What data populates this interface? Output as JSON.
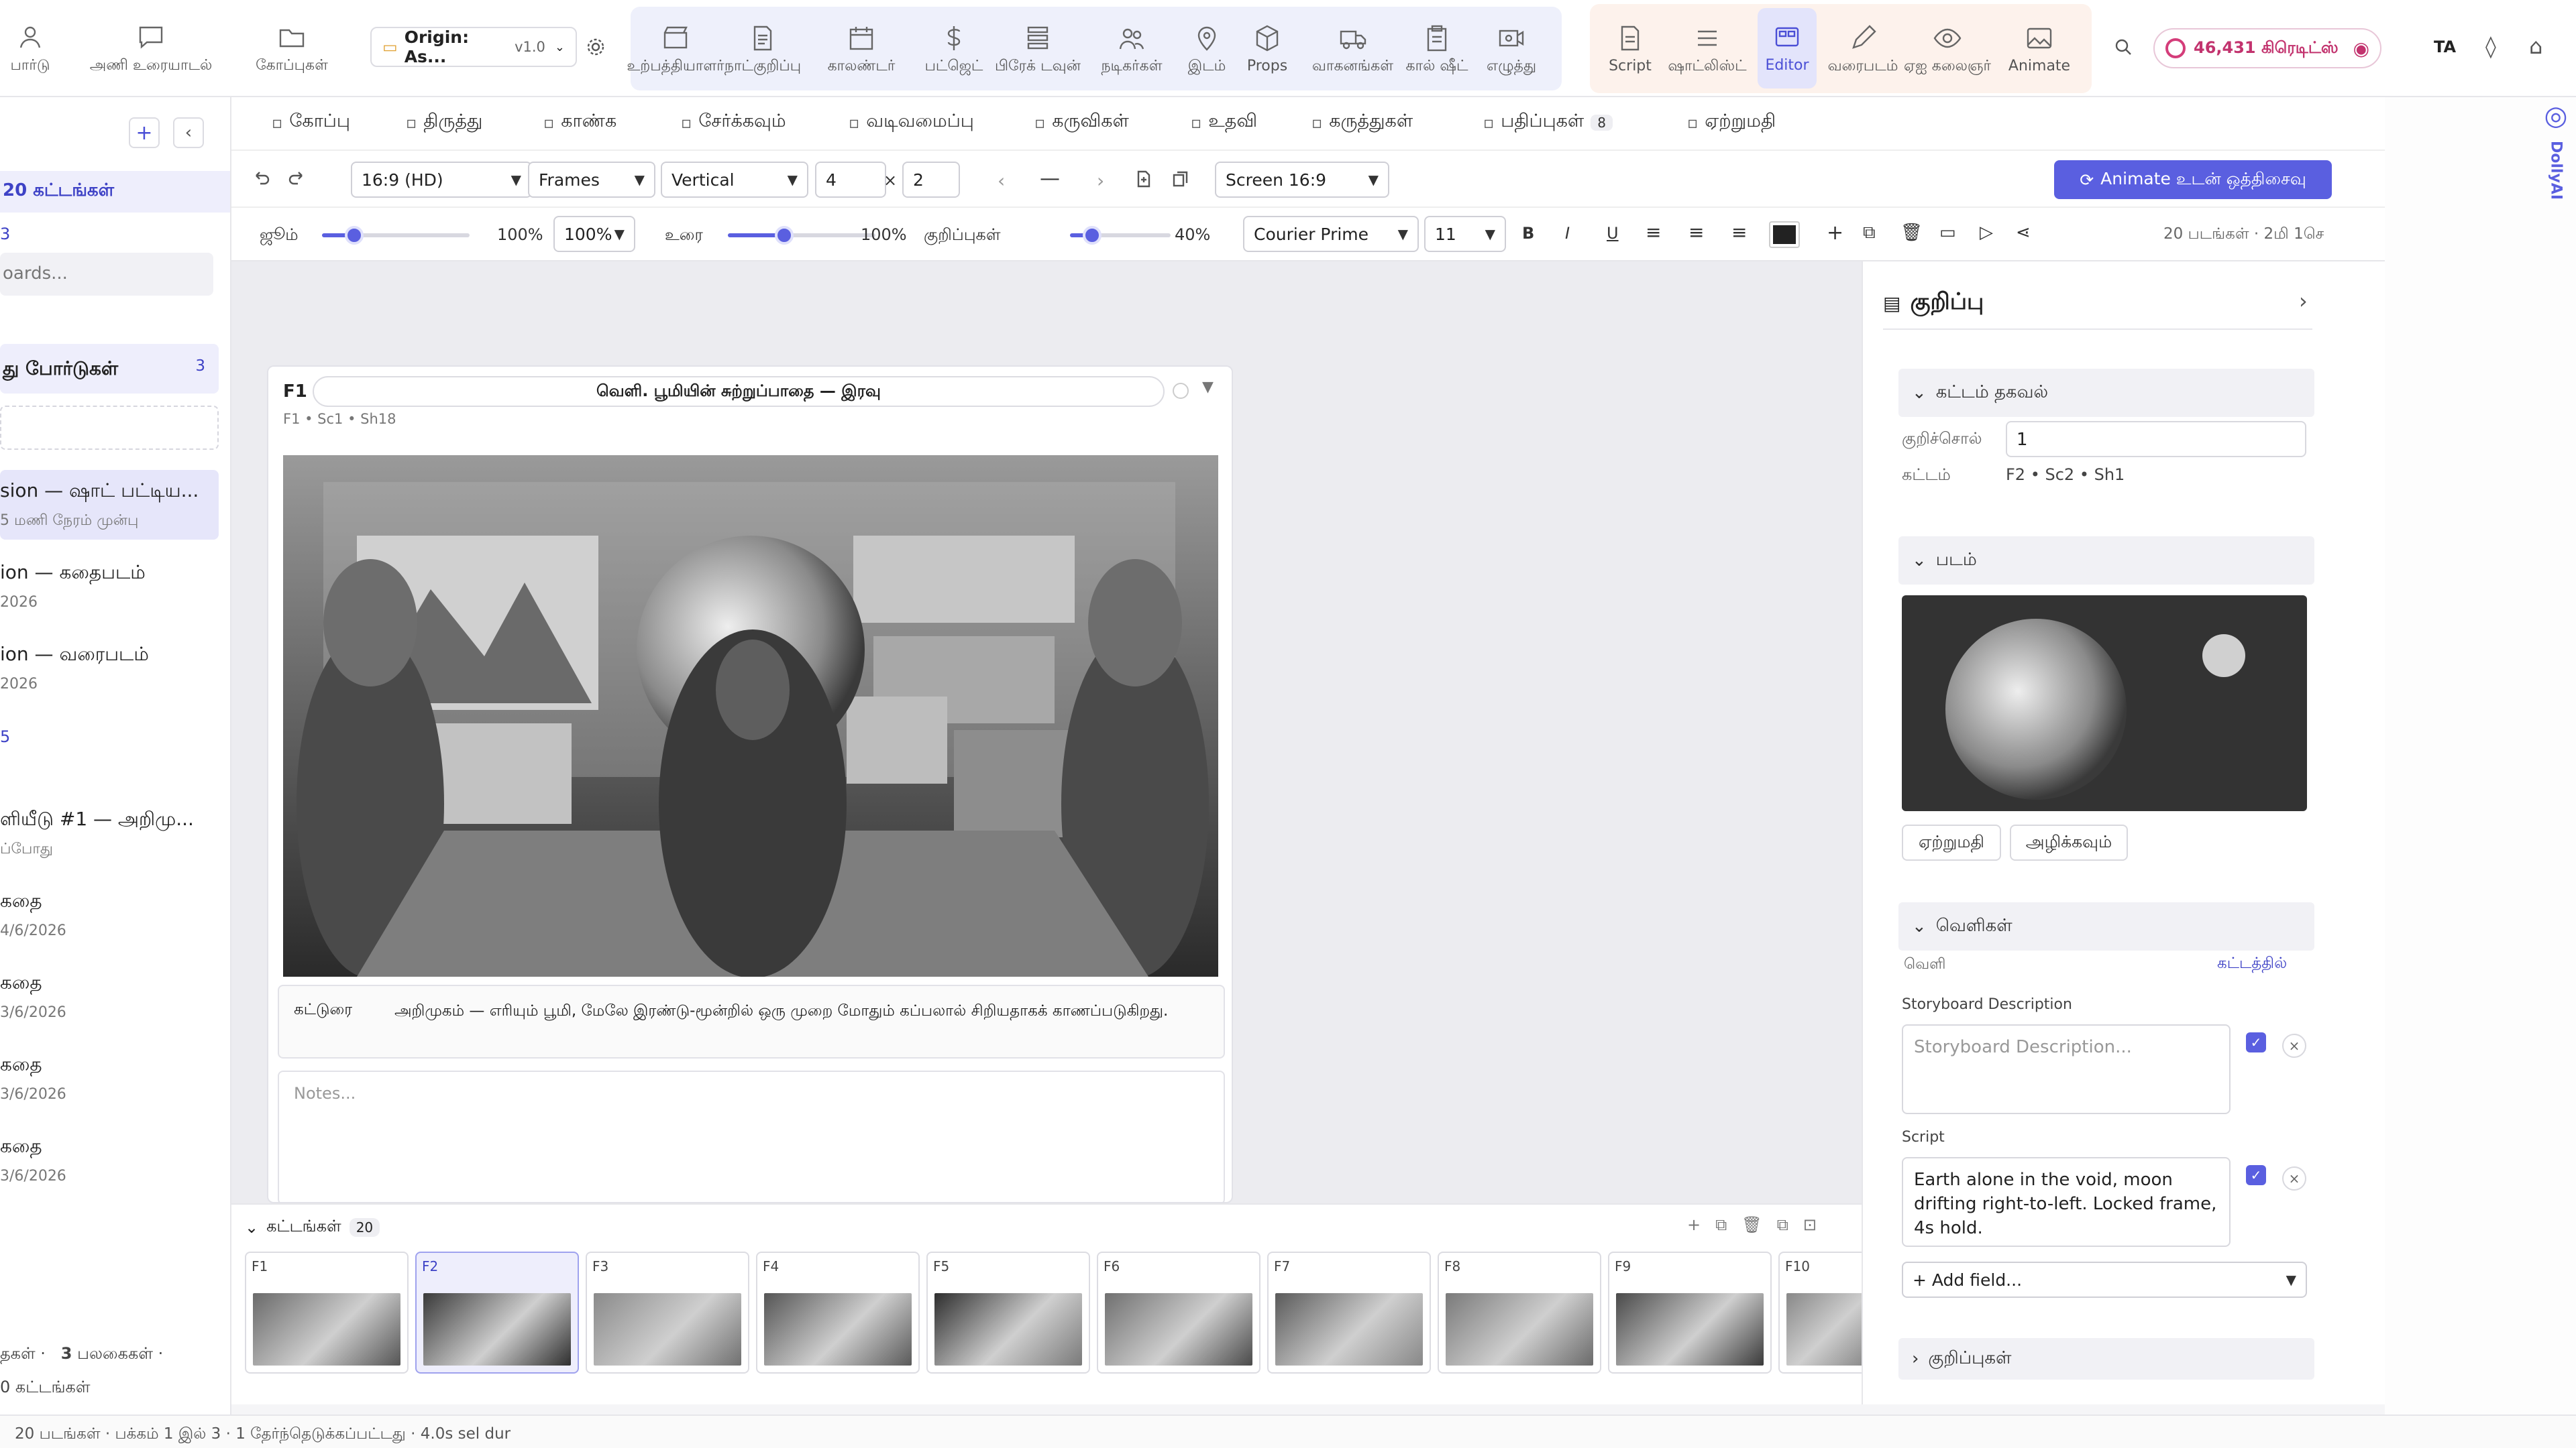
{
  "topbar": {
    "left_items": [
      {
        "label": "பார்டு",
        "icon": "people-icon"
      },
      {
        "label": "அணி உரையாடல்",
        "icon": "chat-icon"
      },
      {
        "label": "கோப்புகள்",
        "icon": "folder-icon"
      }
    ],
    "project": {
      "name": "Origin: As...",
      "version": "v1.0"
    },
    "production_tools": [
      {
        "label": "உற்பத்தியாளர்",
        "icon": "clapper-icon"
      },
      {
        "label": "நாட்குறிப்பு",
        "icon": "document-icon"
      },
      {
        "label": "காலண்டர்",
        "icon": "calendar-icon"
      },
      {
        "label": "பட்ஜெட்",
        "icon": "dollar-icon"
      },
      {
        "label": "பிரேக் டவுன்",
        "icon": "layers-icon"
      },
      {
        "label": "நடிகர்கள்",
        "icon": "cast-icon"
      },
      {
        "label": "இடம்",
        "icon": "location-icon"
      },
      {
        "label": "Props",
        "icon": "box-icon"
      },
      {
        "label": "வாகனங்கள்",
        "icon": "truck-icon"
      },
      {
        "label": "கால் ஷீட்",
        "icon": "clipboard-icon"
      },
      {
        "label": "எழுத்து",
        "icon": "video-icon"
      }
    ],
    "creative_tools": [
      {
        "label": "Script",
        "icon": "script-icon"
      },
      {
        "label": "ஷாட்லிஸ்ட்",
        "icon": "list-icon"
      },
      {
        "label": "Editor",
        "icon": "editor-icon",
        "active": true
      },
      {
        "label": "வரைபடம்",
        "icon": "pencil-icon"
      },
      {
        "label": "ஏஐ கலைஞர்",
        "icon": "eye-icon"
      },
      {
        "label": "Animate",
        "icon": "image-icon"
      }
    ],
    "credits": "46,431 கிரெடிட்ஸ்",
    "lang": "TA"
  },
  "sidebar": {
    "count_label": "20 கட்டங்கள்",
    "count_number": "3",
    "search_placeholder": "oards...",
    "section_title": "து போர்டுகள்",
    "section_count": "3",
    "items": [
      {
        "title": "sion — ஷாட் பட்டிய...",
        "sub": "5 மணி நேரம் முன்பு"
      },
      {
        "title": "ion — கதைபடம்",
        "sub": "2026"
      },
      {
        "title": "ion — வரைபடம்",
        "sub": "2026"
      },
      {
        "title": "5",
        "sub": ""
      },
      {
        "title": "ளியீடு #1 — அறிமு...",
        "sub": "ப்போது"
      },
      {
        "title": "கதை",
        "sub": "4/6/2026"
      },
      {
        "title": "கதை",
        "sub": "3/6/2026"
      },
      {
        "title": "கதை",
        "sub": "3/6/2026"
      },
      {
        "title": "கதை",
        "sub": "3/6/2026"
      }
    ],
    "footer": {
      "a": "தகள்",
      "b_num": "3",
      "b": "பலகைகள்",
      "c_num": "0",
      "c": "கட்டங்கள்"
    }
  },
  "menu": [
    {
      "label": "கோப்பு",
      "icon": "file-icon"
    },
    {
      "label": "திருத்து",
      "icon": "edit-icon"
    },
    {
      "label": "காண்க",
      "icon": "eye-icon"
    },
    {
      "label": "சேர்க்கவும்",
      "icon": "plus-icon"
    },
    {
      "label": "வடிவமைப்பு",
      "icon": "text-icon"
    },
    {
      "label": "கருவிகள்",
      "icon": "wrench-icon"
    },
    {
      "label": "உதவி",
      "icon": "help-icon"
    },
    {
      "label": "கருத்துகள்",
      "icon": "comment-icon"
    },
    {
      "label": "பதிப்புகள்",
      "icon": "history-icon",
      "badge": "8"
    },
    {
      "label": "ஏற்றுமதி",
      "icon": "download-icon"
    }
  ],
  "toolbar2": {
    "aspect": "16:9 (HD)",
    "mode": "Frames",
    "orientation": "Vertical",
    "cols": "4",
    "times": "×",
    "rows": "2",
    "dash": "—",
    "screen": "Screen 16:9",
    "animate_btn": "Animate உடன் ஒத்திசைவு"
  },
  "toolbar3": {
    "zoom_label": "ஜூம்",
    "zoom_value": "100%",
    "zoom_select": "100%",
    "zoom_fraction": 0.22,
    "text_label": "உரை",
    "text_value": "100%",
    "text_fraction": 0.38,
    "notes_label": "குறிப்புகள்",
    "notes_value": "40%",
    "notes_fraction": 0.22,
    "font": "Courier Prime",
    "size": "11",
    "bold": "B",
    "italic": "I",
    "underline": "U",
    "info": "20 படங்கள் · 2மி 1செ"
  },
  "frame": {
    "id": "F1",
    "title": "வெளி. பூமியின் சுற்றுப்பாதை — இரவு",
    "meta": "F1 • Sc1 • Sh18",
    "caption_label": "கட்டுரை",
    "caption_text": "அறிமுகம் — எரியும் பூமி, மேலே இரண்டு-மூன்றில் ஒரு முறை மோதும் கப்பலால் சிறியதாகக் காணப்படுகிறது.",
    "notes_placeholder": "Notes..."
  },
  "strip": {
    "title": "கட்டங்கள்",
    "count": "20",
    "frames": [
      "F1",
      "F2",
      "F3",
      "F4",
      "F5",
      "F6",
      "F7",
      "F8",
      "F9",
      "F10"
    ]
  },
  "panel": {
    "title": "குறிப்பு",
    "frame_info_title": "கட்டம் தகவல்",
    "keyword_label": "குறிச்சொல்",
    "keyword_value": "1",
    "frame_label": "கட்டம்",
    "frame_value": "F2 • Sc2 • Sh1",
    "image_title": "படம்",
    "upload_btn": "ஏற்றுமதி",
    "delete_btn": "அழிக்கவும்",
    "outputs_title": "வெளிகள்",
    "output_label": "வெளி",
    "output_link": "கட்டத்தில்",
    "sb_desc_label": "Storyboard Description",
    "sb_desc_placeholder": "Storyboard Description...",
    "script_label": "Script",
    "script_value": "Earth alone in the void, moon drifting right-to-left. Locked frame, 4s hold.",
    "add_field": "+ Add field...",
    "notes_title": "குறிப்புகள்"
  },
  "right_rail": {
    "label": "DollyAI"
  },
  "status": "20 படங்கள் · பக்கம் 1 இல் 3 · 1 தேர்ந்தெடுக்கப்பட்டது · 4.0s sel dur"
}
